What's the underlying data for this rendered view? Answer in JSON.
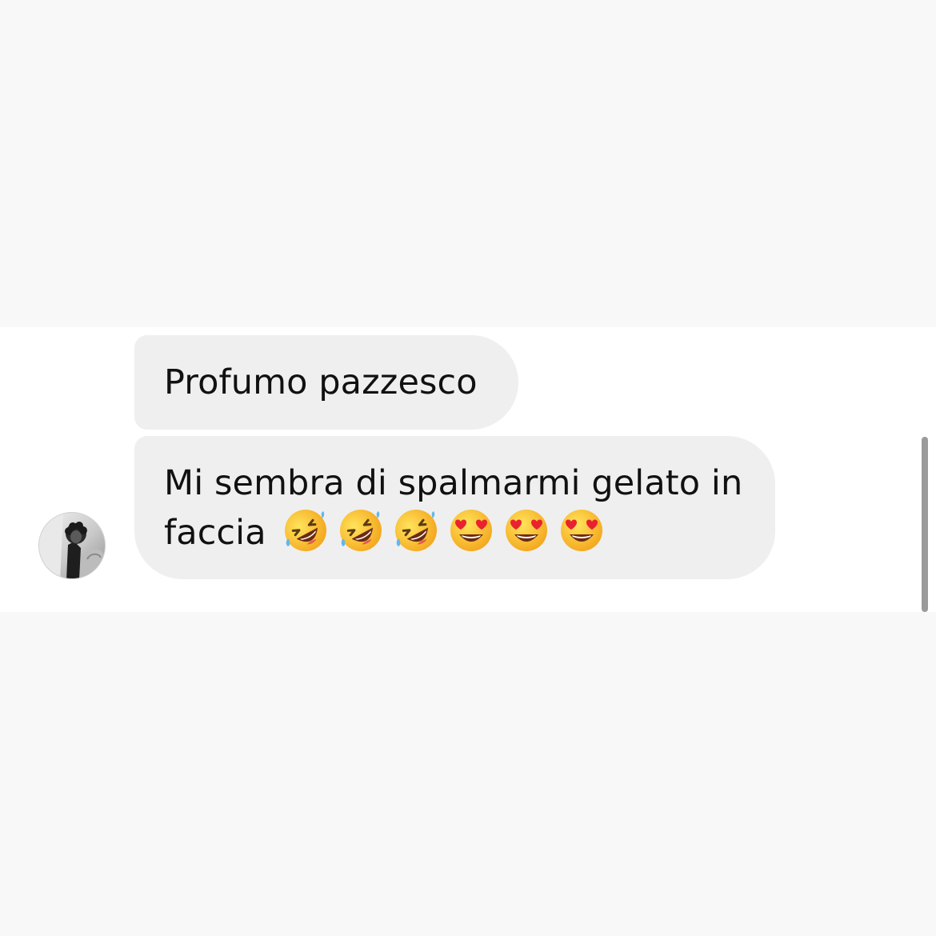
{
  "messages": [
    {
      "sender": "other",
      "text": "Profumo pazzesco"
    },
    {
      "sender": "other",
      "line1": "Mi sembra di spalmarmi gelato in",
      "line2": "faccia",
      "emojis": [
        "rofl-emoji",
        "rofl-emoji",
        "rofl-emoji",
        "heart-eyes-emoji",
        "heart-eyes-emoji",
        "heart-eyes-emoji"
      ]
    }
  ],
  "colors": {
    "page_background": "#f8f8f8",
    "chat_background": "#ffffff",
    "bubble_background": "#efefef",
    "text": "#111111",
    "scrollbar": "#9a9a9a"
  },
  "avatar": {
    "icon": "user-avatar-photo"
  }
}
